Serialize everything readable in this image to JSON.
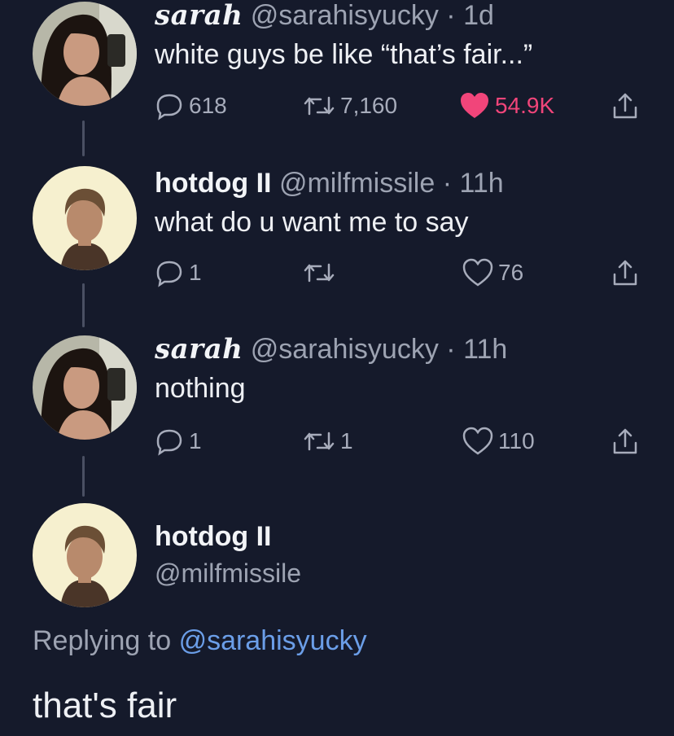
{
  "tweets": [
    {
      "name": "sarah",
      "handle": "@sarahisyucky",
      "separator": "·",
      "time": "1d",
      "text": "white guys be like “that’s fair...”",
      "replies": "618",
      "retweets": "7,160",
      "likes": "54.9K",
      "liked": true
    },
    {
      "name": "hotdog II",
      "handle": "@milfmissile",
      "separator": "·",
      "time": "11h",
      "text": "what do u want me to say",
      "replies": "1",
      "retweets": "",
      "likes": "76",
      "liked": false
    },
    {
      "name": "sarah",
      "handle": "@sarahisyucky",
      "separator": "·",
      "time": "11h",
      "text": "nothing",
      "replies": "1",
      "retweets": "1",
      "likes": "110",
      "liked": false
    }
  ],
  "focus": {
    "name": "hotdog II",
    "handle": "@milfmissile",
    "replying_prefix": "Replying to",
    "replying_to": "@sarahisyucky",
    "text": "that's fair"
  },
  "colors": {
    "background": "#151a2b",
    "like_active": "#f1457a",
    "mention": "#6b9ee8",
    "muted": "#9da3b2"
  },
  "icons": [
    "reply-icon",
    "retweet-icon",
    "heart-icon",
    "share-icon"
  ]
}
